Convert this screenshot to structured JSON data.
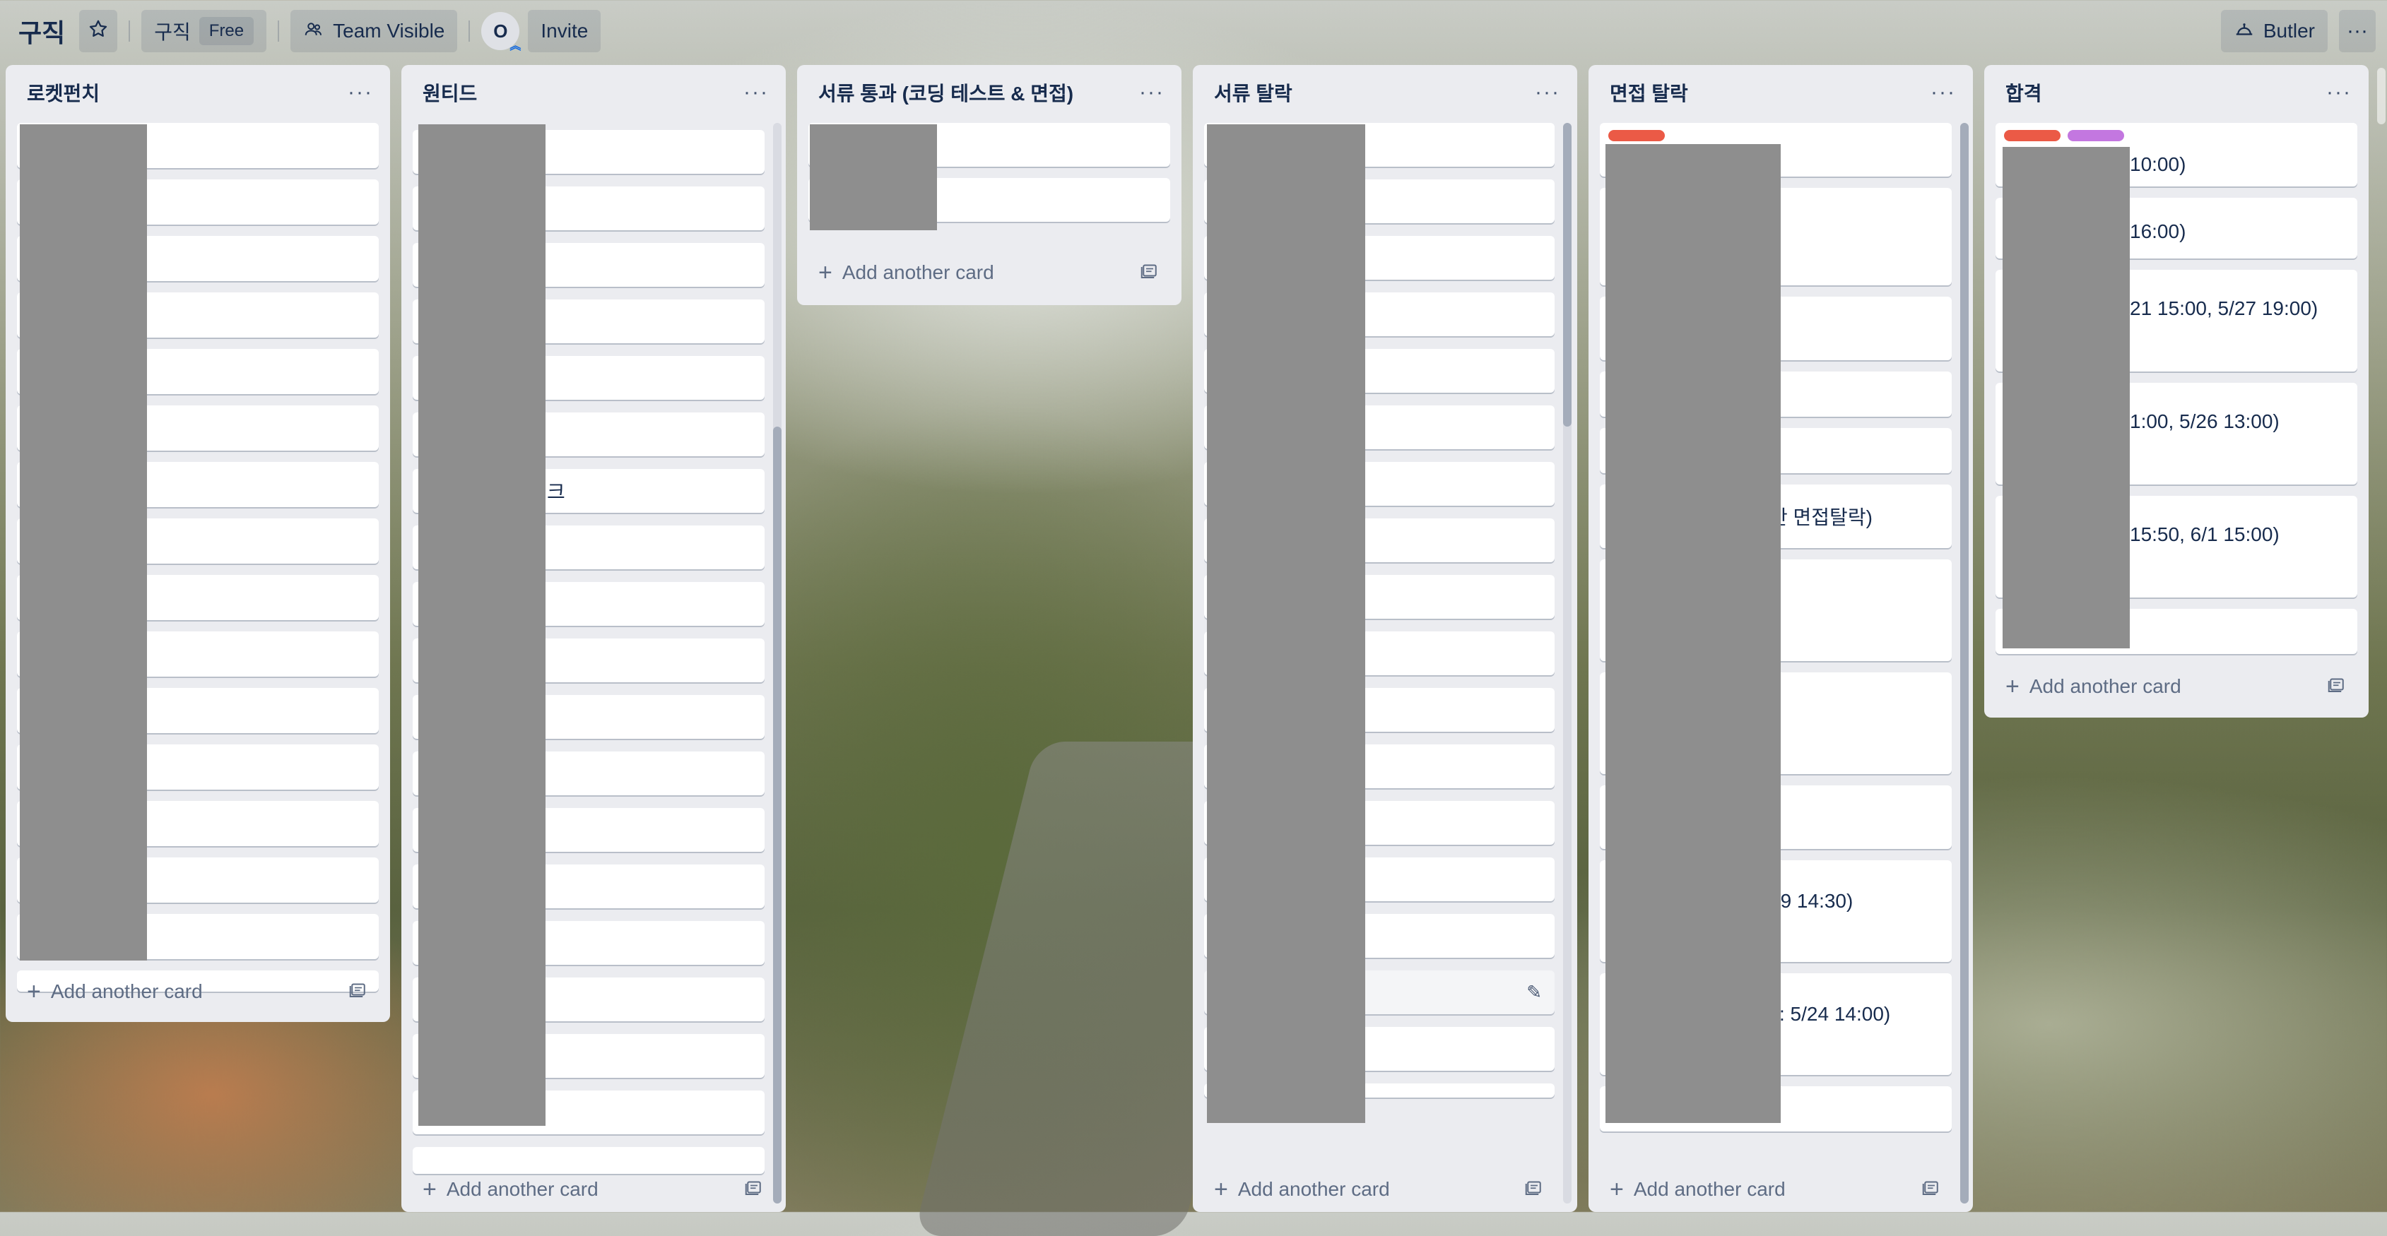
{
  "header": {
    "board_title": "구직",
    "workspace_name": "구직",
    "workspace_plan": "Free",
    "visibility_label": "Team Visible",
    "member_initial": "O",
    "invite_label": "Invite",
    "butler_label": "Butler",
    "star_icon": "star-icon",
    "visibility_icon": "team-icon",
    "butler_icon": "butler-icon",
    "more_icon": "more-icon"
  },
  "colors": {
    "label_red": "#eb5a46",
    "label_purple": "#c377e0",
    "redact": "#8e8e8e"
  },
  "lists": [
    {
      "title": "로켓펀치",
      "menu": "···",
      "add_card": "Add another card",
      "cards": [
        "",
        "",
        "",
        "",
        "",
        "",
        "",
        "",
        "",
        "",
        "",
        "",
        "",
        "",
        "",
        ""
      ]
    },
    {
      "title": "원티드",
      "menu": "···",
      "add_card": "Add another card",
      "cards": [
        "",
        "",
        "",
        "",
        "",
        "",
        "크",
        "",
        "",
        "",
        "",
        "",
        "",
        "",
        "",
        "",
        "",
        "",
        ""
      ]
    },
    {
      "title": "서류 통과 (코딩 테스트 & 면접)",
      "menu": "···",
      "add_card": "Add another card",
      "cards": [
        "",
        ""
      ]
    },
    {
      "title": "서류 탈락",
      "menu": "···",
      "add_card": "Add another card",
      "cards": [
        "",
        "",
        "",
        "",
        "",
        "",
        "",
        "",
        "",
        "",
        "",
        "",
        "",
        "",
        "",
        "",
        "",
        ""
      ]
    },
    {
      "title": "면접 탈락",
      "menu": "···",
      "add_card": "Add another card",
      "cards": [
        "",
        "",
        "",
        "",
        "",
        "안 면접탈락)",
        "",
        ")",
        "",
        "29 14:30)",
        "l : 5/24 14:00)",
        ""
      ]
    },
    {
      "title": "합격",
      "menu": "···",
      "add_card": "Add another card",
      "cards": [
        "10:00)",
        "16:00)",
        "21 15:00, 5/27 19:00)",
        "1:00, 5/26 13:00)",
        " 15:50, 6/1 15:00)",
        ""
      ]
    }
  ]
}
